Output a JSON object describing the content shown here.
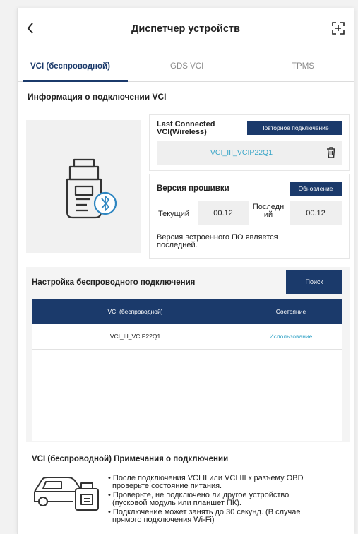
{
  "header": {
    "title": "Диспетчер устройств"
  },
  "tabs": [
    {
      "label": "VCI (беспроводной)",
      "active": true
    },
    {
      "label": "GDS VCI",
      "active": false
    },
    {
      "label": "TPMS",
      "active": false
    }
  ],
  "connection": {
    "section_title": "Информация о подключении VCI",
    "last_connected_label_1": "Last Connected",
    "last_connected_label_2": "VCI(Wireless)",
    "reconnect_button": "Повторное подключение",
    "device_name": "VCI_III_VCIP22Q1"
  },
  "firmware": {
    "title": "Версия прошивки",
    "update_button": "Обновление",
    "current_label": "Текущий",
    "current_value": "00.12",
    "latest_label_1": "Последн",
    "latest_label_2": "ий",
    "latest_value": "00.12",
    "status_line_1": "Версия встроенного ПО является",
    "status_line_2": "последней."
  },
  "wireless": {
    "title": "Настройка беспроводного подключения",
    "search_button": "Поиск",
    "columns": [
      "VCI (беспроводной)",
      "Состояние"
    ],
    "rows": [
      {
        "name": "VCI_III_VCIP22Q1",
        "status": "Использование"
      }
    ]
  },
  "notes": {
    "title": "VCI (беспроводной) Примечания о подключении",
    "lines": [
      "• После подключения VCI II или VCI III к разъему OBD",
      "проверьте состояние питания.",
      "• Проверьте, не подключено ли другое устройство",
      "(пусковой модуль или планшет ПК).",
      "• Подключение может занять до 30 секунд. (В случае",
      "прямого подключения Wi-Fi)"
    ]
  },
  "colors": {
    "navy": "#1b3a6b",
    "link": "#3aa6c8"
  }
}
